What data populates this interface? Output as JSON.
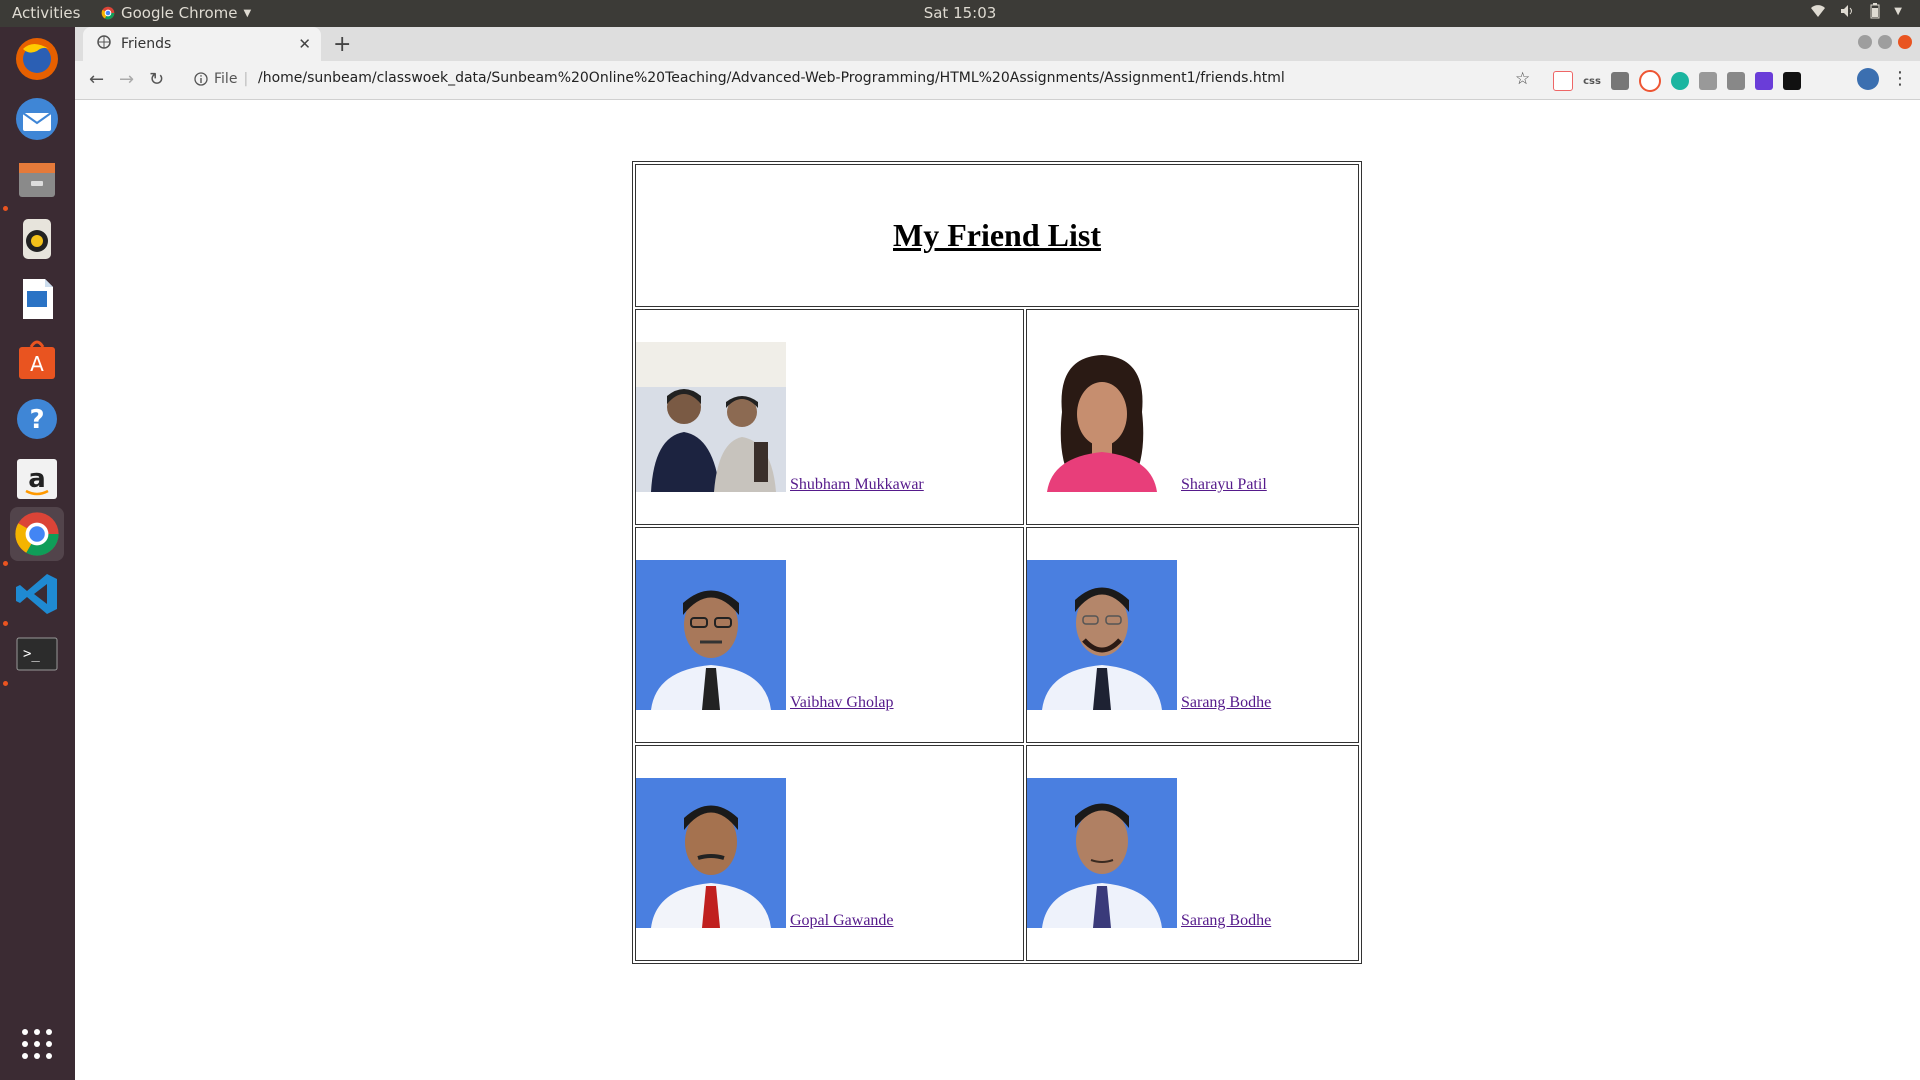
{
  "topbar": {
    "activities": "Activities",
    "app_name": "Google Chrome",
    "clock": "Sat 15:03"
  },
  "dock": {
    "items": [
      "firefox-icon",
      "thunderbird-icon",
      "files-icon",
      "rhythmbox-icon",
      "writer-icon",
      "software-center-icon",
      "help-icon",
      "amazon-icon",
      "chrome-icon",
      "vscode-icon",
      "terminal-icon",
      "app-grid-icon"
    ]
  },
  "browser": {
    "tab_title": "Friends",
    "scheme_label": "File",
    "url": "/home/sunbeam/classwoek_data/Sunbeam%20Online%20Teaching/Advanced-Web-Programming/HTML%20Assignments/Assignment1/friends.html",
    "extension_css_label": "css"
  },
  "page": {
    "heading": "My Friend List",
    "friends": [
      {
        "name": "Shubham Mukkawar"
      },
      {
        "name": "Sharayu Patil"
      },
      {
        "name": "Vaibhav Gholap"
      },
      {
        "name": "Sarang Bodhe"
      },
      {
        "name": "Gopal Gawande"
      },
      {
        "name": "Sarang Bodhe"
      }
    ]
  },
  "colors": {
    "topbar": "#3c3b37",
    "dock": "#3b2b33",
    "link_visited": "#551a8b",
    "photo_blue": "#4a7fe0",
    "accent": "#e95420"
  }
}
